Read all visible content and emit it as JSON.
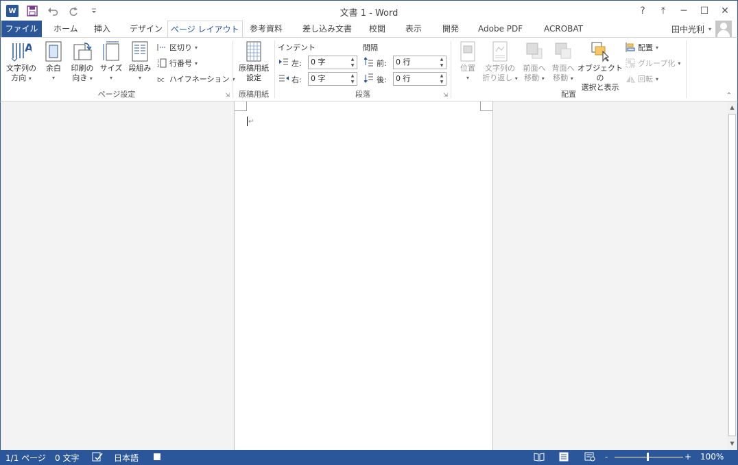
{
  "window": {
    "title": "文書 1 - Word",
    "help": "?",
    "restore_ribbon": "⤒",
    "minimize": "─",
    "maximize": "☐",
    "close": "✕"
  },
  "qat": {
    "app_icon": "W",
    "save_icon": "save-icon",
    "undo_icon": "undo-icon",
    "redo_icon": "redo-icon",
    "customize_icon": "customize-icon"
  },
  "tabs": {
    "file": "ファイル",
    "home": "ホーム",
    "insert": "挿入",
    "design": "デザイン",
    "layout": "ページ レイアウト",
    "references": "参考資料",
    "mailings": "差し込み文書",
    "review": "校閲",
    "view": "表示",
    "developer": "開発",
    "adobe": "Adobe  PDF",
    "acrobat": "ACROBAT"
  },
  "user": {
    "name": "田中光利",
    "caret": "▾"
  },
  "ribbon": {
    "page_setup": {
      "label": "ページ設定",
      "text_direction": [
        "文字列の",
        "方向"
      ],
      "margins": "余白",
      "orientation": [
        "印刷の",
        "向き"
      ],
      "size": "サイズ",
      "columns": "段組み",
      "breaks": "区切り",
      "line_numbers": "行番号",
      "hyphenation": "ハイフネーション"
    },
    "genko": {
      "label": "原稿用紙",
      "settings": [
        "原稿用紙",
        "設定"
      ]
    },
    "paragraph": {
      "label": "段落",
      "indent": "インデント",
      "spacing": "間隔",
      "left": "左:",
      "right": "右:",
      "before": "前:",
      "after": "後:",
      "left_value": "0 字",
      "right_value": "0 字",
      "before_value": "0 行",
      "after_value": "0 行"
    },
    "arrange": {
      "label": "配置",
      "position": "位置",
      "wrap_text": [
        "文字列の",
        "折り返し"
      ],
      "bring_forward": [
        "前面へ",
        "移動"
      ],
      "send_backward": [
        "背面へ",
        "移動"
      ],
      "selection_pane": [
        "オブジェクトの",
        "選択と表示"
      ],
      "align": "配置",
      "group": "グループ化",
      "rotate": "回転"
    }
  },
  "document": {
    "paragraph_mark": "↵"
  },
  "status": {
    "page": "1/1 ページ",
    "words": "0 文字",
    "language": "日本語",
    "zoom": "100%",
    "zoom_minus": "-",
    "zoom_plus": "+",
    "zoom_level": 1.0
  },
  "colors": {
    "accent": "#2b579a"
  }
}
